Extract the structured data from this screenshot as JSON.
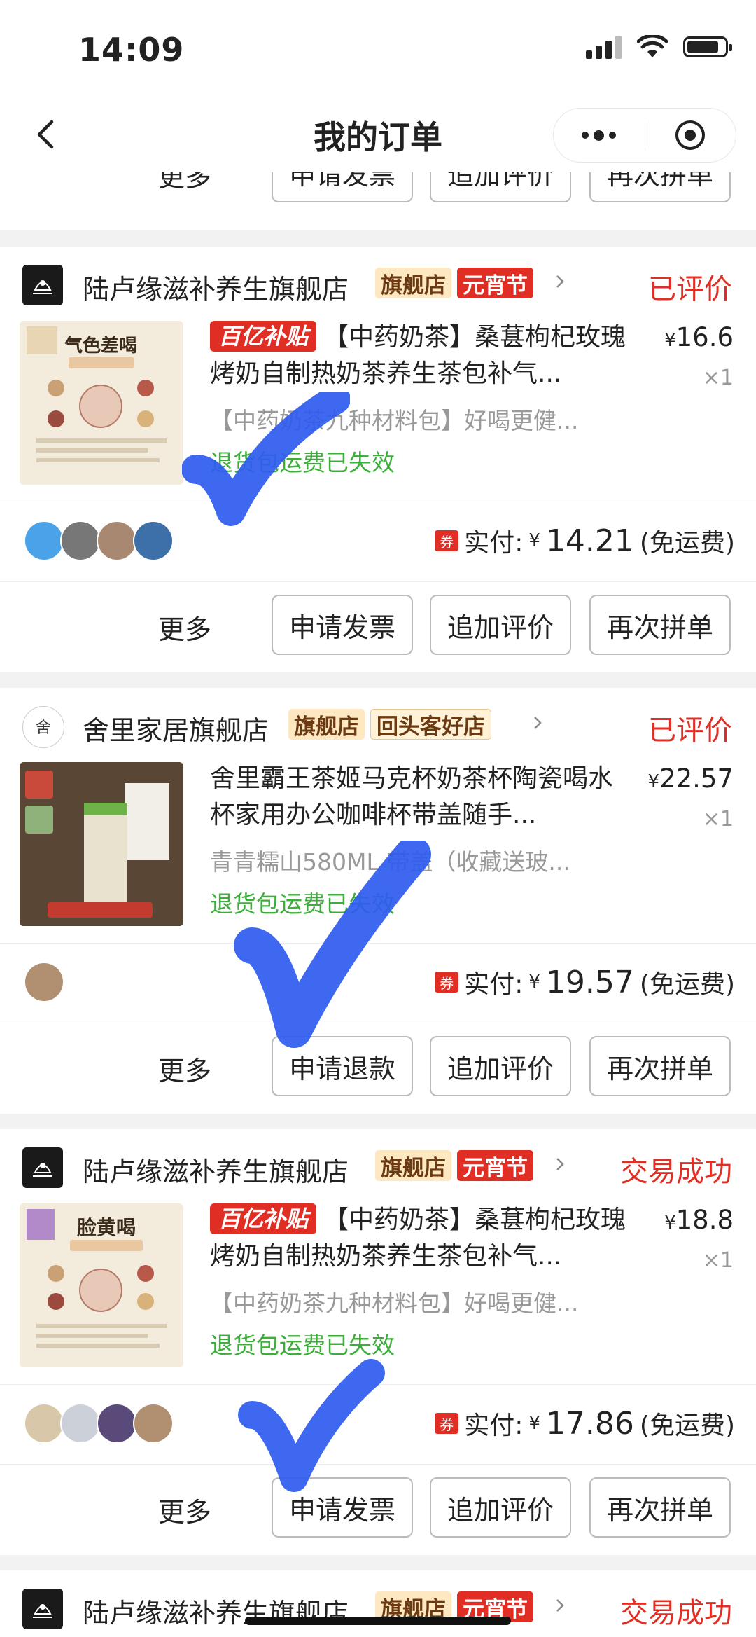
{
  "status_bar": {
    "time": "14:09"
  },
  "nav": {
    "title": "我的订单"
  },
  "top_actions": {
    "more": "更多",
    "b1": "申请发票",
    "b2": "追加评价",
    "b3": "再次拼单"
  },
  "orders": [
    {
      "shop_name": "陆卢缘滋补养生旗舰店",
      "tags": [
        "旗舰店",
        "元宵节"
      ],
      "status": "已评价",
      "promo_badge": "百亿补贴",
      "title": "【中药奶茶】桑葚枸杞玫瑰烤奶自制热奶茶养生茶包补气...",
      "spec": "【中药奶茶九种材料包】好喝更健...",
      "shipping": "退货包运费已失效",
      "price_symbol": "¥",
      "price": "16.6",
      "qty": "×1",
      "thumb_text": "气色差喝",
      "coupon": "券",
      "paid_label": "实付:",
      "paid_amount": "14.21",
      "paid_note": "(免运费)",
      "actions": {
        "more": "更多",
        "b1": "申请发票",
        "b2": "追加评价",
        "b3": "再次拼单"
      }
    },
    {
      "shop_name": "舍里家居旗舰店",
      "tags": [
        "旗舰店",
        "回头客好店"
      ],
      "status": "已评价",
      "promo_badge": "",
      "title": "舍里霸王茶姬马克杯奶茶杯陶瓷喝水杯家用办公咖啡杯带盖随手...",
      "spec": "青青糯山580ML 带盖（收藏送玻...",
      "shipping": "退货包运费已失效",
      "price_symbol": "¥",
      "price": "22.57",
      "qty": "×1",
      "thumb_text": "",
      "coupon": "券",
      "paid_label": "实付:",
      "paid_amount": "19.57",
      "paid_note": "(免运费)",
      "actions": {
        "more": "更多",
        "b1": "申请退款",
        "b2": "追加评价",
        "b3": "再次拼单"
      }
    },
    {
      "shop_name": "陆卢缘滋补养生旗舰店",
      "tags": [
        "旗舰店",
        "元宵节"
      ],
      "status": "交易成功",
      "promo_badge": "百亿补贴",
      "title": "【中药奶茶】桑葚枸杞玫瑰烤奶自制热奶茶养生茶包补气...",
      "spec": "【中药奶茶九种材料包】好喝更健...",
      "shipping": "退货包运费已失效",
      "price_symbol": "¥",
      "price": "18.8",
      "qty": "×1",
      "thumb_text": "脸黄喝",
      "coupon": "券",
      "paid_label": "实付:",
      "paid_amount": "17.86",
      "paid_note": "(免运费)",
      "actions": {
        "more": "更多",
        "b1": "申请发票",
        "b2": "追加评价",
        "b3": "再次拼单"
      }
    },
    {
      "shop_name": "陆卢缘滋补养生旗舰店",
      "tags": [
        "旗舰店",
        "元宵节"
      ],
      "status": "交易成功"
    }
  ],
  "colors": {
    "accent": "#e02e24",
    "green": "#3cae3a",
    "check": "#2f5bf0"
  }
}
